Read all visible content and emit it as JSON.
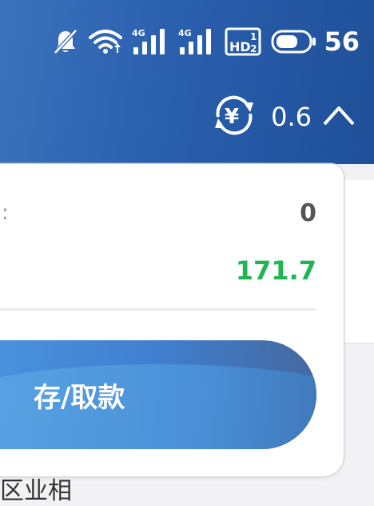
{
  "status_bar": {
    "battery_level": "56",
    "icons": [
      "mute-bell-icon",
      "wifi-icon",
      "signal-4g-icon",
      "signal-4g-icon",
      "hd-icon",
      "battery-icon"
    ]
  },
  "header": {
    "exchange_rate": "0.6",
    "rate_icon": "currency-exchange-icon",
    "expand_icon": "chevron-up-icon"
  },
  "card": {
    "row1": {
      "label_fragment": ":",
      "value": "0"
    },
    "row2": {
      "value": "171.7"
    },
    "action_button_label": "存/取款"
  },
  "bottom": {
    "text_fragment": "区业相"
  },
  "colors": {
    "header_blue": "#2a5fae",
    "positive_green": "#1fb553",
    "value_gray": "#555555"
  }
}
